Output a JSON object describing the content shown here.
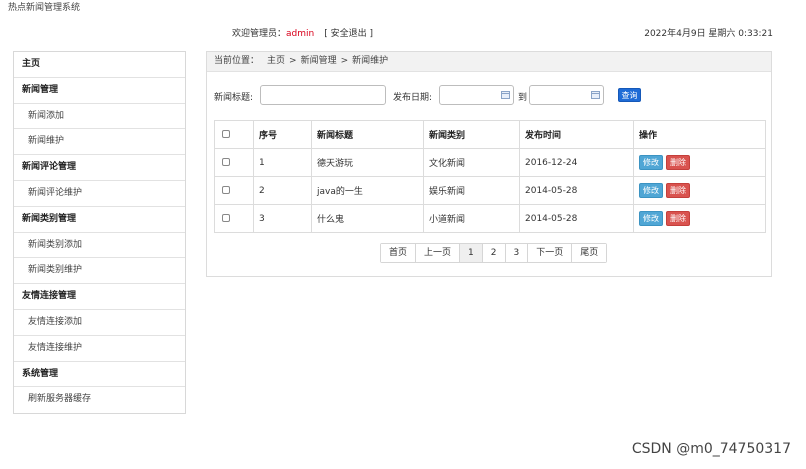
{
  "site": {
    "title": "热点新闻管理系统"
  },
  "header": {
    "welcome_label": "欢迎管理员：",
    "admin_name": "admin",
    "logout_label": "[ 安全退出 ]",
    "datetime": "2022年4月9日 星期六 0:33:21"
  },
  "sidebar": {
    "items": [
      {
        "label": "主页",
        "type": "head"
      },
      {
        "label": "新闻管理",
        "type": "head"
      },
      {
        "label": "新闻添加",
        "type": "sub"
      },
      {
        "label": "新闻维护",
        "type": "sub"
      },
      {
        "label": "新闻评论管理",
        "type": "head"
      },
      {
        "label": "新闻评论维护",
        "type": "sub"
      },
      {
        "label": "新闻类别管理",
        "type": "head"
      },
      {
        "label": "新闻类别添加",
        "type": "sub"
      },
      {
        "label": "新闻类别维护",
        "type": "sub"
      },
      {
        "label": "友情连接管理",
        "type": "head"
      },
      {
        "label": "友情连接添加",
        "type": "sub"
      },
      {
        "label": "友情连接维护",
        "type": "sub"
      },
      {
        "label": "系统管理",
        "type": "head"
      },
      {
        "label": "刷新服务器缓存",
        "type": "sub"
      }
    ]
  },
  "breadcrumb": {
    "lead": "当前位置：",
    "items": [
      "主页",
      "新闻管理",
      "新闻维护"
    ],
    "separator": ">"
  },
  "search": {
    "title_label": "新闻标题:",
    "title_value": "",
    "date_label": "发布日期:",
    "date_from": "",
    "to_label": "到",
    "date_to": "",
    "query_label": "查询"
  },
  "table": {
    "headers": [
      "",
      "序号",
      "新闻标题",
      "新闻类别",
      "发布时间",
      "操作"
    ],
    "edit_label": "修改",
    "delete_label": "删除",
    "rows": [
      {
        "no": "1",
        "title": "德天游玩",
        "category": "文化新闻",
        "date": "2016-12-24"
      },
      {
        "no": "2",
        "title": "java的一生",
        "category": "娱乐新闻",
        "date": "2014-05-28"
      },
      {
        "no": "3",
        "title": "什么鬼",
        "category": "小道新闻",
        "date": "2014-05-28"
      }
    ]
  },
  "pagination": {
    "items": [
      "首页",
      "上一页",
      "1",
      "2",
      "3",
      "下一页",
      "尾页"
    ],
    "active": "1"
  },
  "watermark": "CSDN @m0_74750317",
  "colors": {
    "admin_name": "#d9001b",
    "query_button": "#1e6bd6",
    "edit_button": "#4fa6d5",
    "delete_button": "#d9534f",
    "breadcrumb_bg": "#f2f2f2"
  }
}
